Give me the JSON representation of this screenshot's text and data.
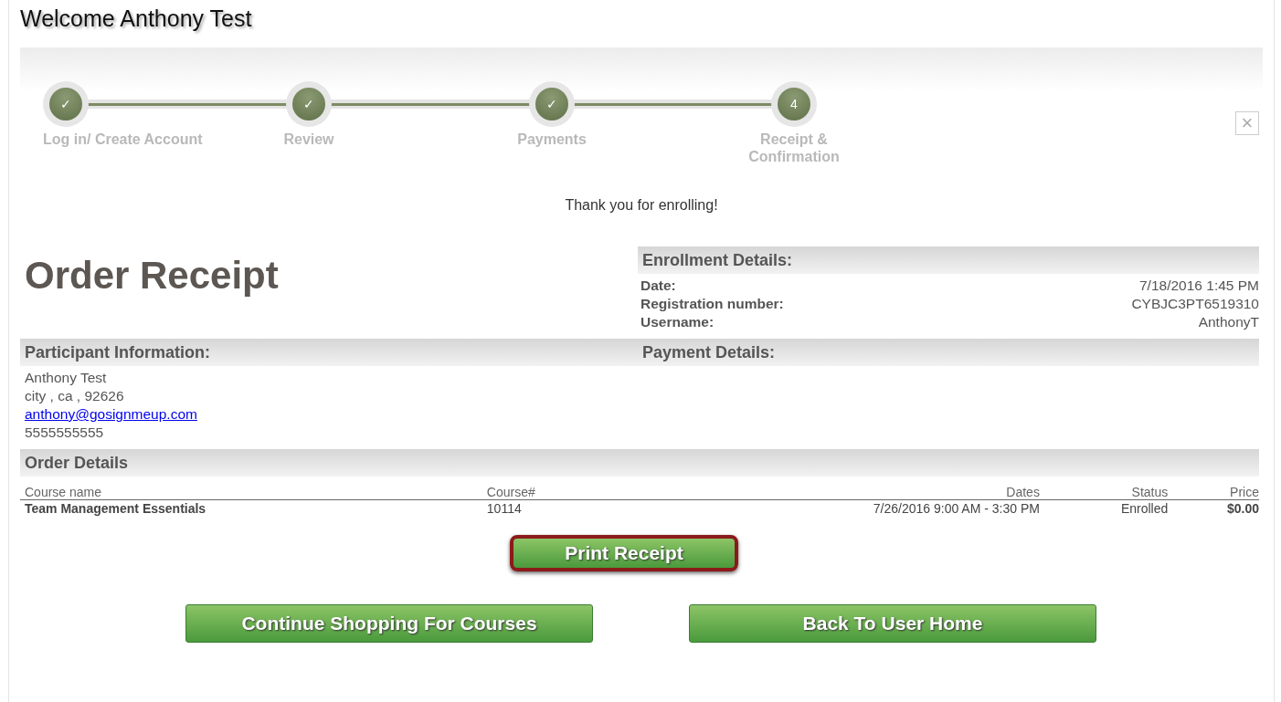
{
  "welcome": "Welcome Anthony Test",
  "steps": [
    {
      "label": "Log in/ Create Account",
      "mark": "✓"
    },
    {
      "label": "Review",
      "mark": "✓"
    },
    {
      "label": "Payments",
      "mark": "✓"
    },
    {
      "label": "Receipt & Confirmation",
      "mark": "4"
    }
  ],
  "close_symbol": "×",
  "thank_you": "Thank you for enrolling!",
  "heading": "Order Receipt",
  "enrollment": {
    "title": "Enrollment Details:",
    "rows": [
      {
        "label": "Date:",
        "value": "7/18/2016 1:45 PM"
      },
      {
        "label": "Registration number:",
        "value": "CYBJC3PT6519310"
      },
      {
        "label": "Username:",
        "value": "AnthonyT"
      }
    ]
  },
  "participant": {
    "title": "Participant Information:",
    "name": "Anthony Test",
    "address": "city , ca , 92626",
    "email": "anthony@gosignmeup.com",
    "phone": "5555555555"
  },
  "payment": {
    "title": "Payment Details:"
  },
  "order": {
    "title": "Order Details",
    "columns": [
      "Course name",
      "Course#",
      "Dates",
      "Status",
      "Price"
    ],
    "rows": [
      [
        "Team Management Essentials",
        "10114",
        "7/26/2016 9:00 AM - 3:30 PM",
        "Enrolled",
        "$0.00"
      ]
    ]
  },
  "print_button": {
    "label": "Print Receipt",
    "highlighted": true
  },
  "buttons": [
    "Continue Shopping For Courses",
    "Back To User Home"
  ]
}
